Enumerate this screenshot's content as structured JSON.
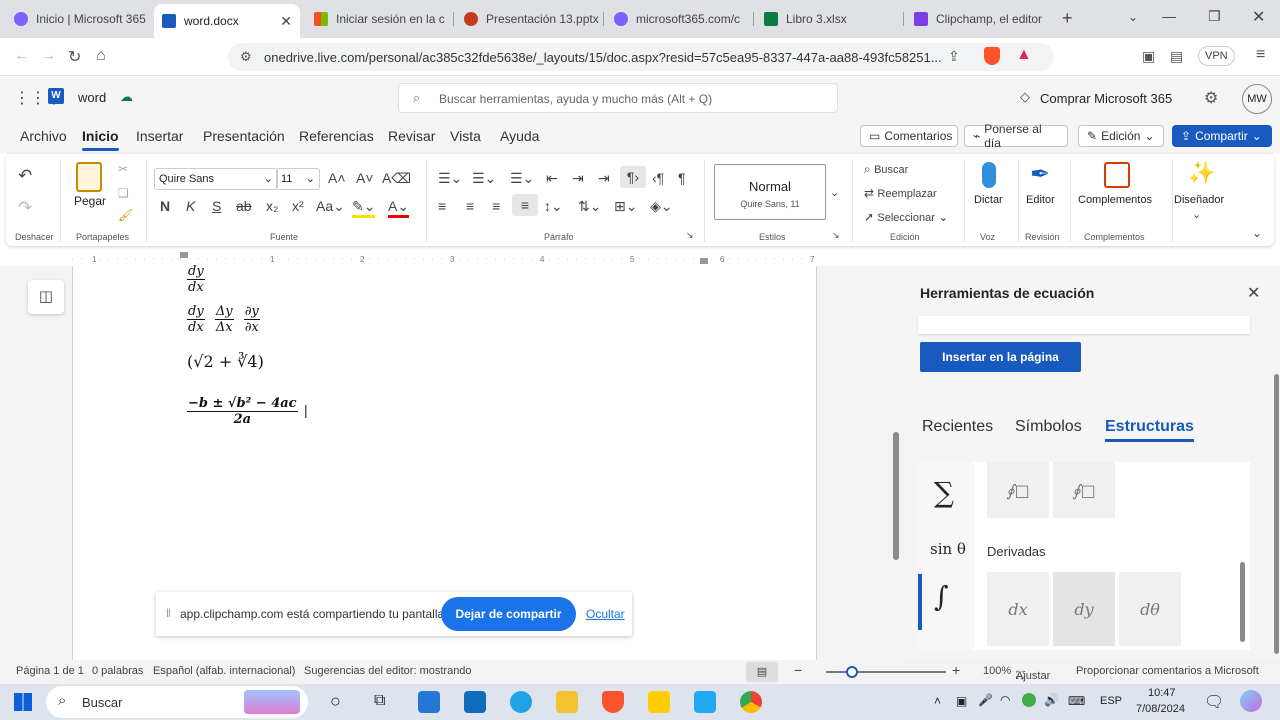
{
  "browser": {
    "tabs": [
      {
        "title": "Inicio | Microsoft 365",
        "color": "#7b61ff"
      },
      {
        "title": "word.docx",
        "color": "#185abd"
      },
      {
        "title": "Iniciar sesión en la c",
        "color": "#f25022"
      },
      {
        "title": "Presentación 13.pptx",
        "color": "#c43e1c"
      },
      {
        "title": "microsoft365.com/c",
        "color": "#7b61ff"
      },
      {
        "title": "Libro 3.xlsx",
        "color": "#107c41"
      },
      {
        "title": "Clipchamp, el editor",
        "color": "#7b3fe4"
      }
    ],
    "url": "onedrive.live.com/personal/ac385c32fde5638e/_layouts/15/doc.aspx?resid=57c5ea95-8337-447a-aa88-493fc58251...",
    "vpn": "VPN"
  },
  "app": {
    "name": "word",
    "search_placeholder": "Buscar herramientas, ayuda y mucho más (Alt + Q)",
    "buy": "Comprar Microsoft 365",
    "avatar": "MW"
  },
  "menu": {
    "items": [
      "Archivo",
      "Inicio",
      "Insertar",
      "Presentación",
      "Referencias",
      "Revisar",
      "Vista",
      "Ayuda"
    ],
    "comments": "Comentarios",
    "catchup": "Ponerse al día",
    "edit": "Edición",
    "share": "Compartir"
  },
  "ribbon": {
    "undo_group": "Deshacer",
    "paste": "Pegar",
    "clipboard_group": "Portapapeles",
    "font_name": "Quire Sans",
    "font_size": "11",
    "font_group": "Fuente",
    "bold": "N",
    "italic": "K",
    "underline": "S",
    "strike": "ab",
    "paragraph_group": "Párrafo",
    "style_name": "Normal",
    "style_sub": "Quire Sans, 11",
    "styles_group": "Estilos",
    "find": "Buscar",
    "replace": "Reemplazar",
    "select": "Seleccionar",
    "edit_group": "Edición",
    "dictate": "Dictar",
    "voice_group": "Voz",
    "editor": "Editor",
    "review_group": "Revisión",
    "addins": "Complementos",
    "addins_group": "Complementos",
    "designer": "Diseñador"
  },
  "document": {
    "eq1_num": "dy",
    "eq1_den": "dx",
    "eq2_num1": "dy",
    "eq2_den1": "dx",
    "eq2_num2": "Δy",
    "eq2_den2": "Δx",
    "eq2_num3": "∂y",
    "eq2_den3": "∂x",
    "eq3": "(√2 + ∛4)",
    "eq4_num": "−b ± √b² − 4ac",
    "eq4_den": "2a"
  },
  "share_bar": {
    "message": "app.clipchamp.com está compartiendo tu pantalla.",
    "stop": "Dejar de compartir",
    "hide": "Ocultar"
  },
  "panel": {
    "title": "Herramientas de ecuación",
    "insert": "Insertar en la página",
    "tabs": [
      "Recientes",
      "Símbolos",
      "Estructuras"
    ],
    "section": "Derivadas",
    "side_sum": "∑",
    "side_sin": "sin θ",
    "side_int": "∫",
    "cells_top": [
      "∮□",
      "∮□"
    ],
    "cells_deriv": [
      "dx",
      "dy",
      "dθ"
    ]
  },
  "status": {
    "page": "Página 1 de 1",
    "words": "0 palabras",
    "lang": "Español (alfab. internacional)",
    "suggestions": "Sugerencias del editor: mostrando",
    "zoom": "100%",
    "fit": "Ajustar",
    "feedback": "Proporcionar comentarios a Microsoft"
  },
  "taskbar": {
    "search": "Buscar",
    "lang": "ESP",
    "time": "10:47",
    "date": "7/08/2024"
  }
}
